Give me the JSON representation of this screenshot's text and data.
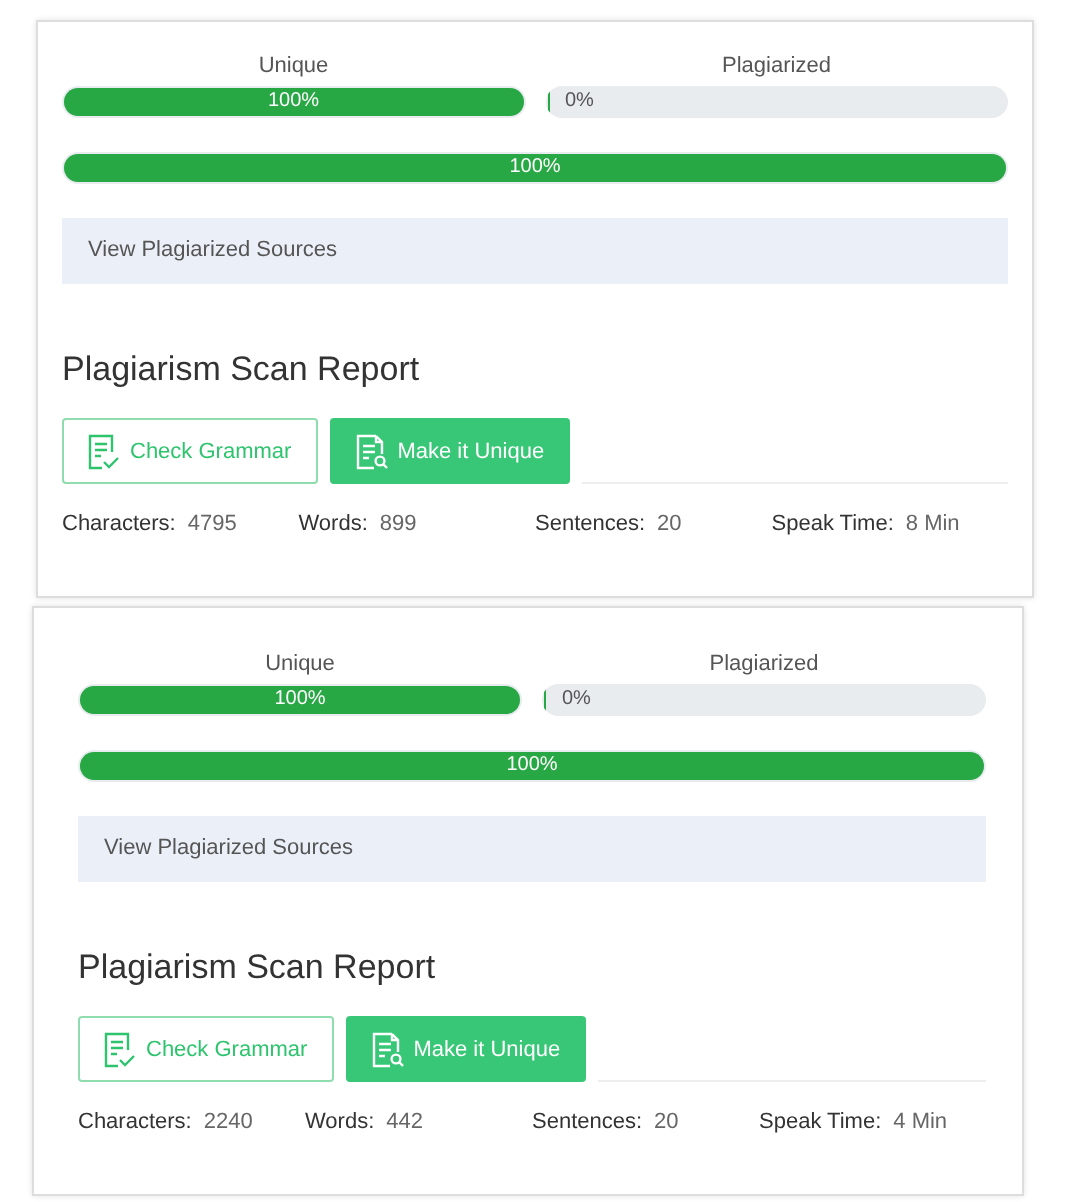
{
  "reports": [
    {
      "bars": [
        {
          "label": "Unique",
          "reading": "100%",
          "level": 1
        },
        {
          "label": "Plagiarized",
          "reading": "0%",
          "level": 0
        }
      ],
      "overall": {
        "reading": "100%",
        "level": 1
      },
      "sources_link": "View Plagiarized Sources",
      "title": "Plagiarism Scan Report",
      "buttons": [
        {
          "label": "Check Grammar",
          "kind": "outline"
        },
        {
          "label": "Make it Unique",
          "kind": "solid"
        }
      ],
      "stats": [
        {
          "label": "Characters:",
          "value": "4795"
        },
        {
          "label": "Words:",
          "value": "899"
        },
        {
          "label": "Sentences:",
          "value": "20"
        },
        {
          "label": "Speak Time:",
          "value": "8 Min"
        }
      ]
    },
    {
      "bars": [
        {
          "label": "Unique",
          "reading": "100%",
          "level": 1
        },
        {
          "label": "Plagiarized",
          "reading": "0%",
          "level": 0
        }
      ],
      "overall": {
        "reading": "100%",
        "level": 1
      },
      "sources_link": "View Plagiarized Sources",
      "title": "Plagiarism Scan Report",
      "buttons": [
        {
          "label": "Check Grammar",
          "kind": "outline"
        },
        {
          "label": "Make it Unique",
          "kind": "solid"
        }
      ],
      "stats": [
        {
          "label": "Characters:",
          "value": "2240"
        },
        {
          "label": "Words:",
          "value": "442"
        },
        {
          "label": "Sentences:",
          "value": "20"
        },
        {
          "label": "Speak Time:",
          "value": "4 Min"
        }
      ]
    }
  ]
}
